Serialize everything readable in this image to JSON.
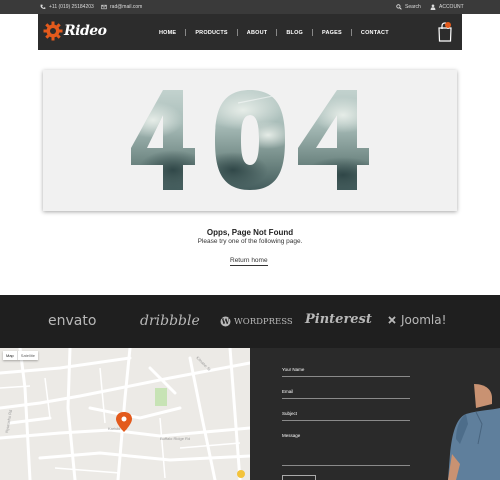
{
  "topbar": {
    "phone": "+11 (019) 25184203",
    "email": "rad@mail.com",
    "search_label": "Search",
    "account_label": "ACCOUNT"
  },
  "header": {
    "brand": "Rideo",
    "nav": [
      {
        "label": "HOME"
      },
      {
        "label": "PRODUCTS"
      },
      {
        "label": "ABOUT"
      },
      {
        "label": "BLOG"
      },
      {
        "label": "PAGES"
      },
      {
        "label": "CONTACT"
      }
    ]
  },
  "error": {
    "code": "404",
    "title": "Opps, Page Not Found",
    "subtitle": "Please try one of the following page.",
    "return_label": "Return home"
  },
  "brands": [
    "envato",
    "dribbble",
    "WordPress",
    "Pinterest",
    "Joomla!"
  ],
  "map": {
    "map_label": "Map",
    "satellite_label": "Satellite"
  },
  "contact": {
    "fields": [
      {
        "label": "Your Name"
      },
      {
        "label": "Email"
      },
      {
        "label": "Subject"
      },
      {
        "label": "Message"
      }
    ]
  },
  "colors": {
    "accent": "#e35a1c",
    "dark_header": "#2c2c2c",
    "brands_bg": "#1f1f1f",
    "contact_bg": "#2a2a2a"
  }
}
